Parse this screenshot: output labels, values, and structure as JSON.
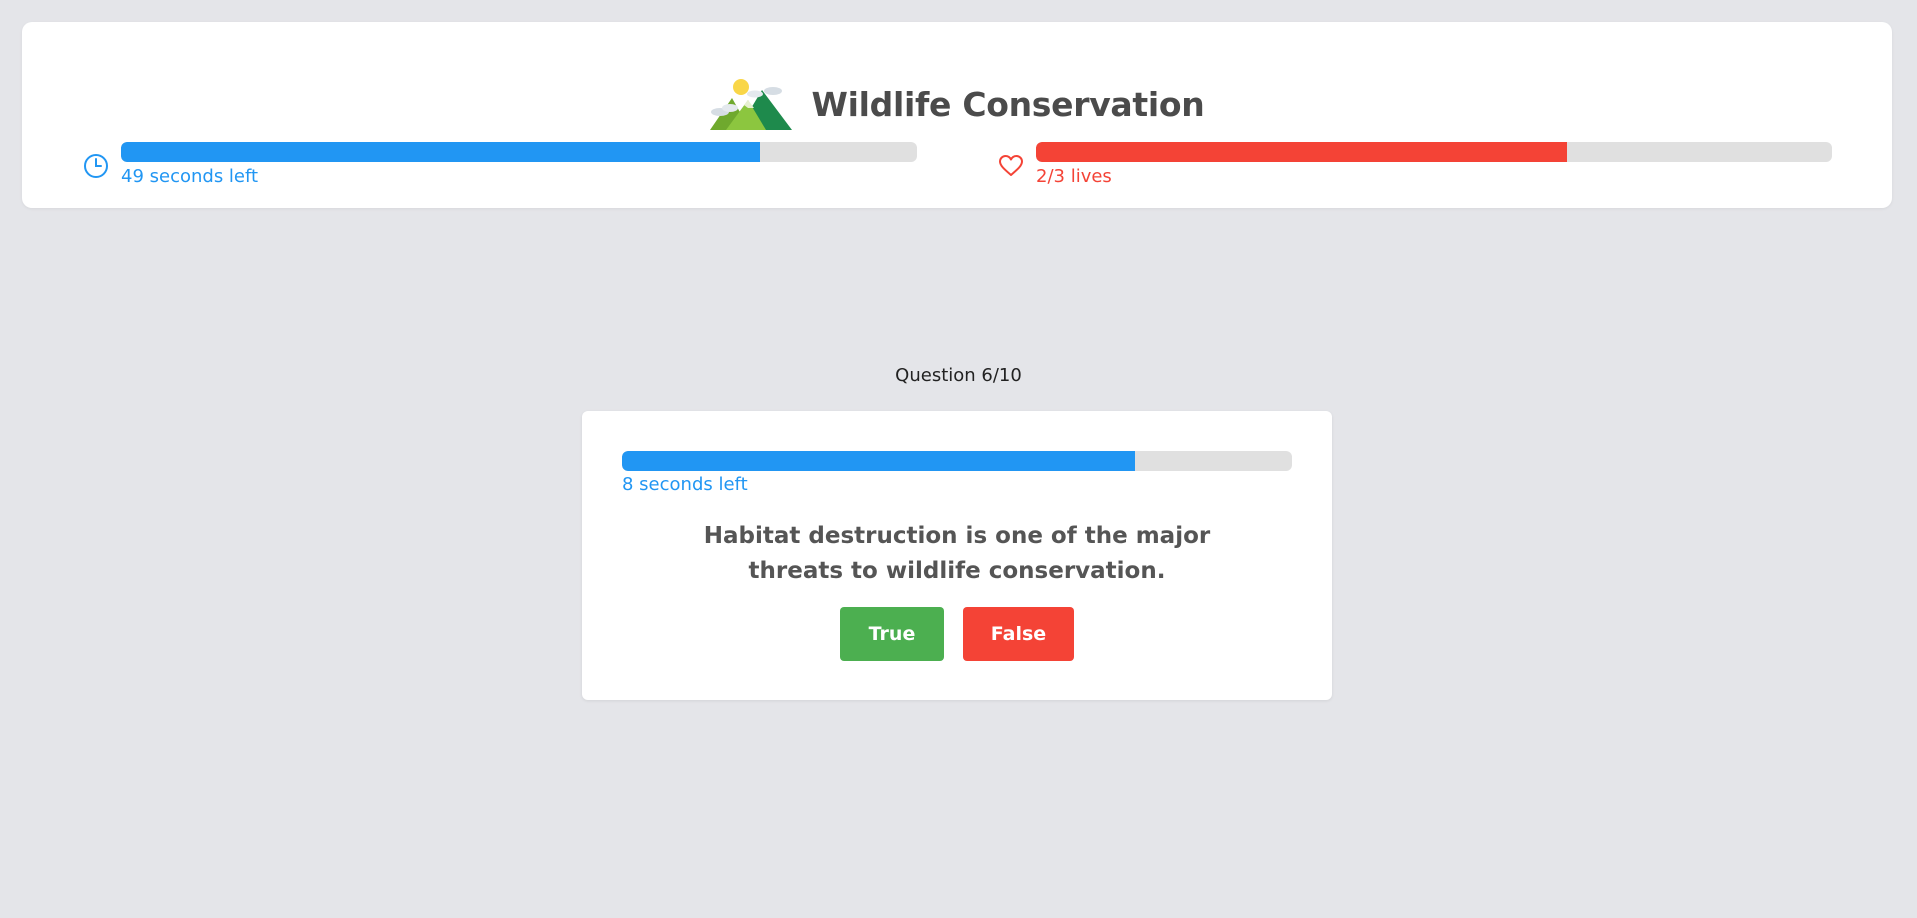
{
  "header": {
    "title": "Wildlife Conservation",
    "logo_icon": "mountain-landscape-icon"
  },
  "game_timer": {
    "icon": "clock-icon",
    "label": "49 seconds left",
    "progress": 0.803,
    "color": "#2196f3"
  },
  "lives": {
    "icon": "heart-icon",
    "label": "2/3 lives",
    "progress": 0.667,
    "color": "#f44336"
  },
  "question": {
    "counter": "Question 6/10",
    "timer_label": "8 seconds left",
    "timer_progress": 0.765,
    "text": "Habitat destruction is one of the major threats to wildlife conservation.",
    "true_label": "True",
    "false_label": "False",
    "true_color": "#4caf50",
    "false_color": "#f44336"
  },
  "colors": {
    "background": "#e4e5e9",
    "track": "#e0e0e0",
    "title_text": "#4b4b4b"
  }
}
